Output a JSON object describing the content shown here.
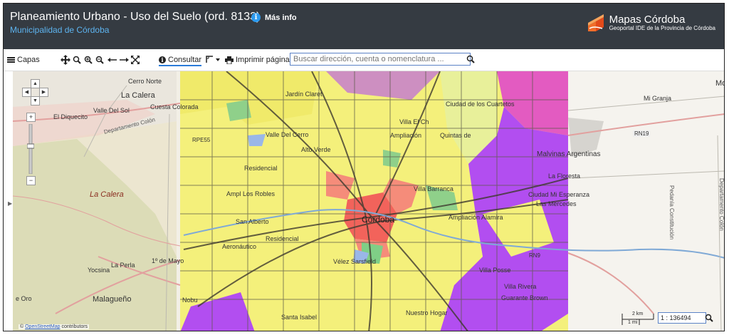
{
  "header": {
    "title": "Planeamiento Urbano - Uso del Suelo (ord. 8133)",
    "more_info": "Más info",
    "subtitle": "Municipalidad de Córdoba",
    "brand_name": "Mapas Córdoba",
    "brand_tagline": "Geoportal IDE de la Provincia de Córdoba"
  },
  "toolbar": {
    "layers_label": "Capas",
    "consult_label": "Consultar",
    "print_label": "Imprimir página",
    "search_placeholder": "Buscar dirección, cuenta o nomenclatura ...",
    "icons": [
      "menu-icon",
      "pan-icon",
      "search-zoom-icon",
      "zoom-in-icon",
      "zoom-out-icon",
      "arrow-left-icon",
      "arrow-right-icon",
      "fullscreen-icon",
      "info-icon",
      "measure-icon",
      "caret-down-icon",
      "print-icon",
      "search-icon"
    ]
  },
  "map": {
    "labels": {
      "cerro_norte": "Cerro Norte",
      "la_calera_top": "La Calera",
      "cuesta_colorada": "Cuesta Colorada",
      "valle_del_sol": "Valle Del Sol",
      "el_diquecito": "El Diquecito",
      "departamento_colon": "Departamento Colón",
      "la_calera_dept": "La Calera",
      "jardin_claret": "Jardín Claret",
      "ciudad_cuartetos": "Ciudad de los Cuartetos",
      "quintas_de_argüello": "Quintas de",
      "villa_el_ch": "Villa El Ch",
      "ampliacion_ferreyra": "Ampliación",
      "rpe55": "RPE55",
      "valle_del_cerro": "Valle Del Cerro",
      "alto_verde": "Alto Verde",
      "residencial": "Residencial",
      "amp_los_robles": "Ampl Los Robles",
      "san_alberto": "San Alberto",
      "residencial_2": "Residencial",
      "aeronautico": "Aeronáutico",
      "cordoba": "Córdoba",
      "villa_barranca": "Villa Barranca",
      "ampliacion_alamira": "Ampliación Alamira",
      "vaz_sarsfield": "Vélez Sarsfield",
      "ciudad_mi_esperanza": "Ciudad Mi Esperanza",
      "las_mercedes": "Las Mercedes",
      "la_floresta": "La Floresta",
      "malvinas_argentinas": "Malvinas Argentinas",
      "mi_granja": "Mi Granja",
      "rn19": "RN19",
      "rn9": "RN9",
      "la_perla": "La Perla",
      "yocsina": "Yocsina",
      "primero_de_mayo": "1º de Mayo",
      "malagueno": "Malagueño",
      "ore": "e Oro",
      "nobu": "Nobu",
      "nuestro_hogar": "Nuestro Hogar",
      "villa_posse": "Villa Posse",
      "guaranteed_brown": "Guarante Brown",
      "san_isabel": "Santa Isabel",
      "villa_rivera": "Villa Rivera",
      "mo": "Mo",
      "pedania_constitucion": "Pedanía Constitución",
      "departamento_colon_right": "Departamento Colón"
    },
    "scale_km": "2 km",
    "scale_mi": "1 mi",
    "scale_ratio": "1 : 136494",
    "attribution_link": "OpenStreetMap",
    "attribution_suffix": "contributors"
  },
  "colors": {
    "header_bg": "#353b42",
    "link_blue": "#5db4f0",
    "zone_yellow": "#f4f07b",
    "zone_purple": "#b24ef0",
    "zone_red": "#f2635b",
    "zone_pink": "#e35bc1"
  }
}
